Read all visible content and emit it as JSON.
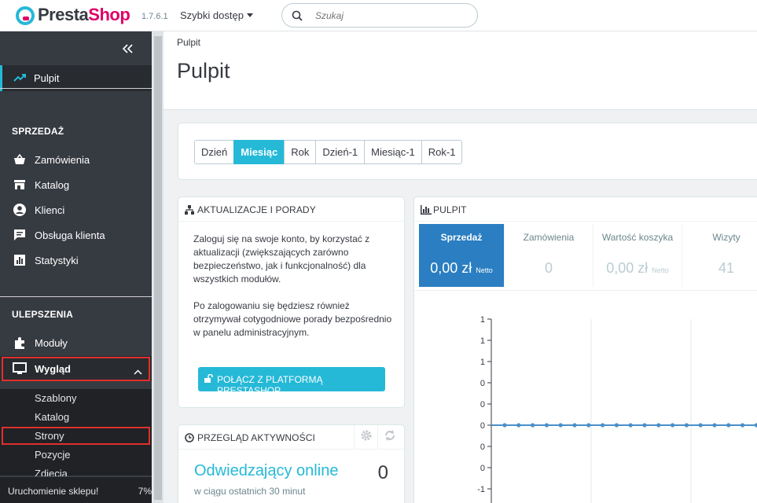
{
  "header": {
    "brand_presta": "Presta",
    "brand_shop": "Shop",
    "version": "1.7.6.1",
    "quick_access": "Szybki dostęp",
    "search_placeholder": "Szukaj"
  },
  "sidebar": {
    "active": {
      "label": "Pulpit",
      "icon": "trending-up-icon"
    },
    "sections": [
      {
        "title": "SPRZEDAŻ",
        "items": [
          {
            "label": "Zamówienia",
            "icon": "basket-icon"
          },
          {
            "label": "Katalog",
            "icon": "store-icon"
          },
          {
            "label": "Klienci",
            "icon": "account-icon"
          },
          {
            "label": "Obsługa klienta",
            "icon": "chat-icon"
          },
          {
            "label": "Statystyki",
            "icon": "bar-chart-icon"
          }
        ]
      },
      {
        "title": "ULEPSZENIA",
        "items": [
          {
            "label": "Moduły",
            "icon": "puzzle-icon"
          },
          {
            "label": "Wygląd",
            "icon": "desktop-icon"
          }
        ]
      }
    ],
    "submenu": [
      "Szablony",
      "Katalog",
      "Strony",
      "Pozycje",
      "Zdjęcia"
    ],
    "footer_label": "Uruchomienie sklepu!",
    "footer_pct": "7%"
  },
  "page": {
    "breadcrumb": "Pulpit",
    "title": "Pulpit"
  },
  "periods": {
    "options": [
      "Dzień",
      "Miesiąc",
      "Rok",
      "Dzień-1",
      "Miesiąc-1",
      "Rok-1"
    ],
    "selected": "Miesiąc"
  },
  "updates": {
    "title": "AKTUALIZACJE I PORADY",
    "para1": "Zaloguj się na swoje konto, by korzystać z aktualizacji (zwiększających zarówno bezpieczeństwo, jak i funkcjonalność) dla wszystkich modułów.",
    "para2": "Po zalogowaniu się będziesz również otrzymywał cotygodniowe porady bezpośrednio w panelu administracyjnym.",
    "button": "POŁĄCZ Z PLATFORMĄ PRESTASHOP"
  },
  "activity": {
    "title": "PRZEGLĄD AKTYWNOŚCI",
    "online_label": "Odwiedzający online",
    "online_count": "0",
    "online_sub": "w ciągu ostatnich 30 minut"
  },
  "dashboard": {
    "title": "PULPIT",
    "kpis": [
      {
        "label": "Sprzedaż",
        "value": "0,00 zł",
        "suffix": "Netto"
      },
      {
        "label": "Zamówienia",
        "value": "0",
        "suffix": ""
      },
      {
        "label": "Wartość koszyka",
        "value": "0,00 zł",
        "suffix": "Netto"
      },
      {
        "label": "Wizyty",
        "value": "41",
        "suffix": ""
      }
    ]
  },
  "chart_data": {
    "type": "line",
    "y_tick_labels": [
      "1",
      "1",
      "1",
      "0",
      "0",
      "0",
      "0",
      "0",
      "-1"
    ],
    "series": [
      {
        "values": [
          0,
          0,
          0,
          0,
          0,
          0,
          0,
          0,
          0,
          0,
          0,
          0,
          0,
          0,
          0,
          0,
          0,
          0,
          0,
          0
        ]
      }
    ],
    "grid": true,
    "legend": "none"
  },
  "colors": {
    "accent": "#25b9d7",
    "brand_pink": "#df0067",
    "sidebar": "#363a41",
    "highlight_box": "#e0302b",
    "kpi_active": "#2a7ec1",
    "series": "#4a90c8"
  }
}
